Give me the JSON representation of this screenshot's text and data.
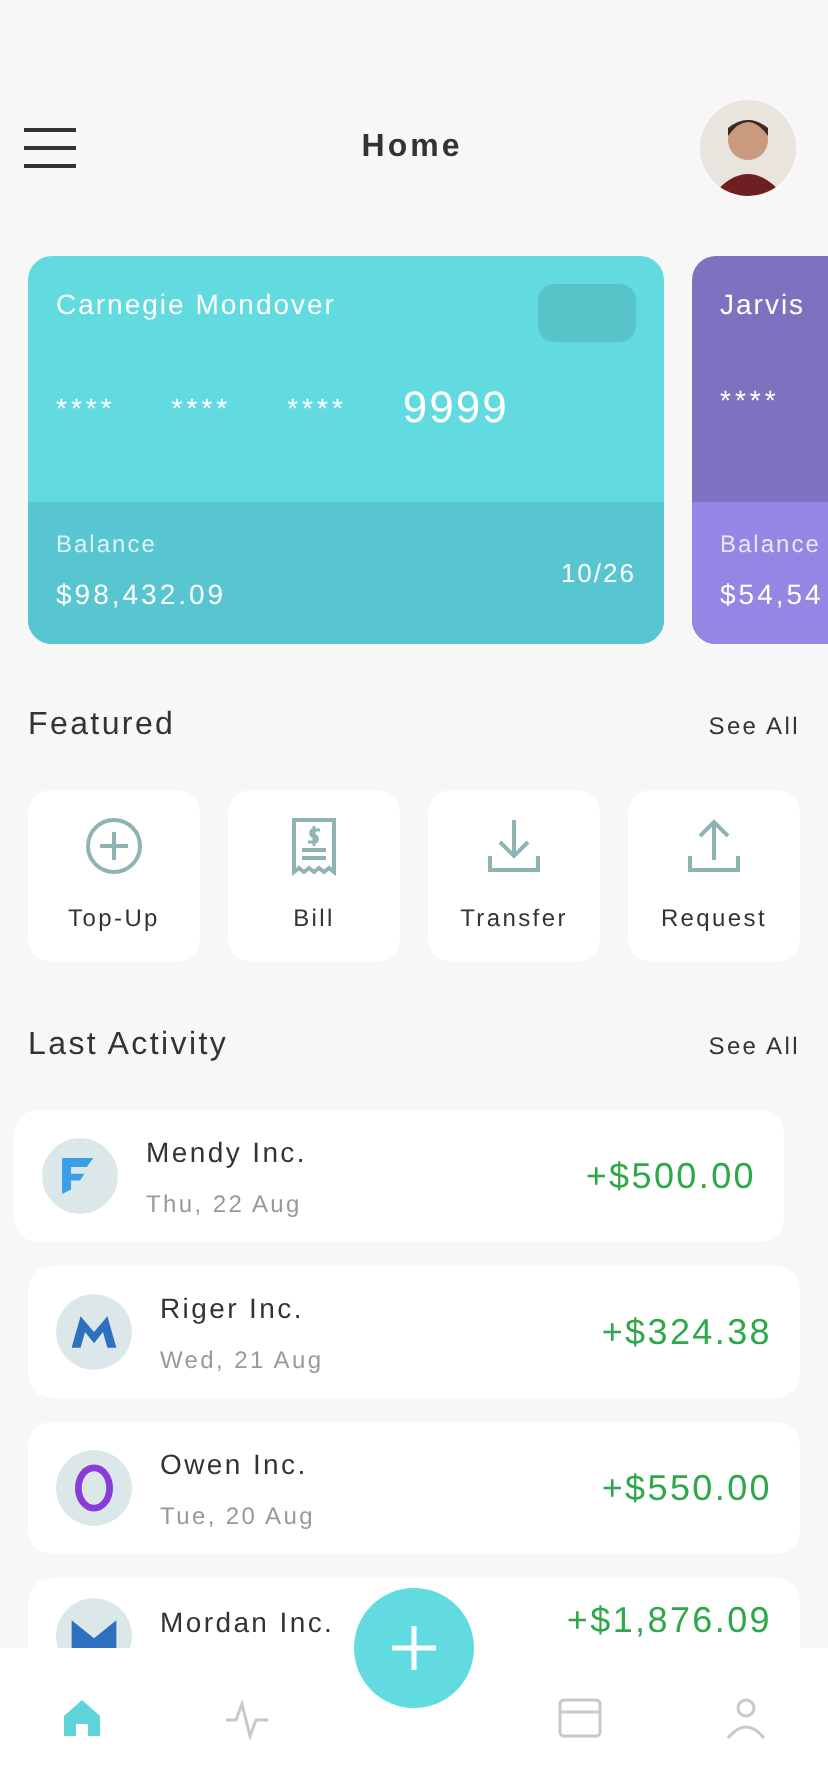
{
  "header": {
    "title": "Home"
  },
  "cards": [
    {
      "holder": "Carnegie Mondover",
      "groups": [
        "****",
        "****",
        "****",
        "9999"
      ],
      "balance_label": "Balance",
      "balance": "$98,432.09",
      "expiry": "10/26",
      "color": "#62dbe0"
    },
    {
      "holder": "Jarvis",
      "groups": [
        "****"
      ],
      "balance_label": "Balance",
      "balance": "$54,54",
      "color": "#7e72c0"
    }
  ],
  "featured": {
    "title": "Featured",
    "link": "See All",
    "items": [
      {
        "label": "Top-Up"
      },
      {
        "label": "Bill"
      },
      {
        "label": "Transfer"
      },
      {
        "label": "Request"
      }
    ]
  },
  "activity": {
    "title": "Last Activity",
    "link": "See All",
    "items": [
      {
        "name": "Mendy Inc.",
        "date": "Thu, 22 Aug",
        "amount": "+$500.00"
      },
      {
        "name": "Riger Inc.",
        "date": "Wed, 21 Aug",
        "amount": "+$324.38"
      },
      {
        "name": "Owen Inc.",
        "date": "Tue, 20 Aug",
        "amount": "+$550.00"
      },
      {
        "name": "Mordan Inc.",
        "amount": "+$1,876.09"
      }
    ]
  },
  "nav": [
    {
      "selected": true
    },
    {
      "selected": false
    },
    {
      "selected": false
    },
    {
      "selected": false
    }
  ]
}
